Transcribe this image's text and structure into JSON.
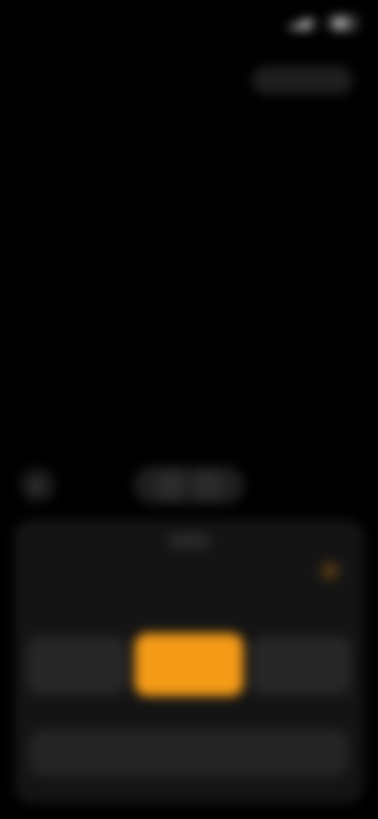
{
  "status_bar": {
    "time": "",
    "icons": [
      "signal-icon",
      "wifi-icon",
      "battery-icon"
    ]
  },
  "top_chip": {
    "label": ""
  },
  "zoom": {
    "options": [
      "",
      ""
    ]
  },
  "panel": {
    "corner_icon": "settings-icon",
    "modes": [
      {
        "label": "",
        "button": ""
      },
      {
        "label": "",
        "button": ""
      },
      {
        "label": "",
        "button": ""
      }
    ],
    "bottom_action": ""
  },
  "colors": {
    "accent": "#f39a17",
    "panel": "#141414",
    "background": "#000000"
  }
}
